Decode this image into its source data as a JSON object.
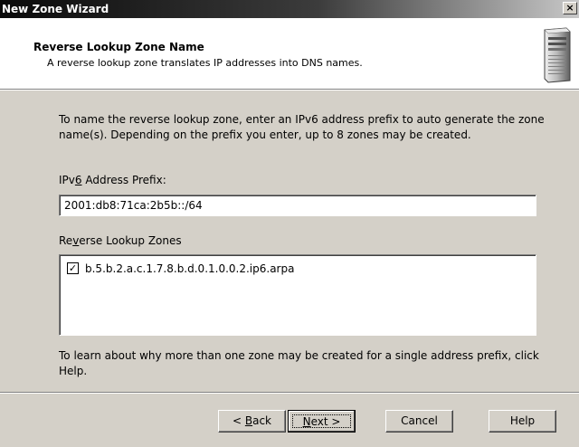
{
  "window": {
    "title": "New Zone Wizard",
    "close_label": "×"
  },
  "header": {
    "title": "Reverse Lookup Zone Name",
    "subtitle": "A reverse lookup zone translates IP addresses into DNS names.",
    "icon": "server-icon"
  },
  "body": {
    "intro": "To name the reverse lookup zone, enter an IPv6 address prefix to auto generate the zone name(s).  Depending on the prefix you enter, up to 8 zones may be created.",
    "prefix_label_pre": "IPv",
    "prefix_label_mnemonic": "6",
    "prefix_label_post": " Address Prefix:",
    "prefix_value": "2001:db8:71ca:2b5b::/64",
    "zones_label_pre": "Re",
    "zones_label_mnemonic": "v",
    "zones_label_post": "erse Lookup Zones",
    "zones": [
      {
        "checked": true,
        "check_glyph": "✓",
        "label": "b.5.b.2.a.c.1.7.8.b.d.0.1.0.0.2.ip6.arpa"
      }
    ],
    "help_text": "To learn about why more than one zone may be created for a single address prefix, click Help."
  },
  "buttons": {
    "back_pre": "< ",
    "back_mnemonic": "B",
    "back_post": "ack",
    "next_mnemonic": "N",
    "next_post": "ext >",
    "cancel": "Cancel",
    "help": "Help"
  }
}
